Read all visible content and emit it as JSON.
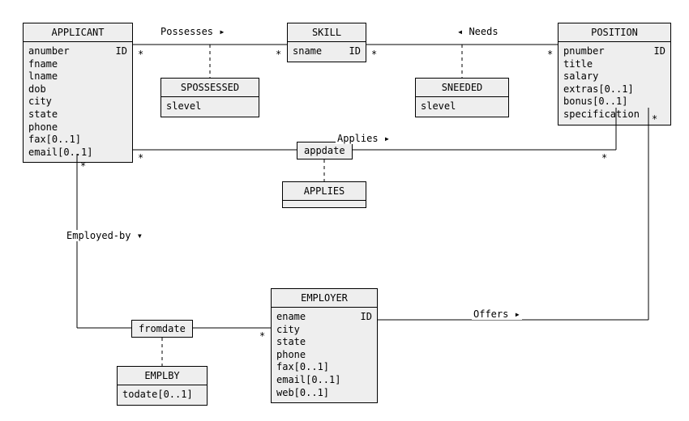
{
  "entities": {
    "applicant": {
      "title": "APPLICANT",
      "attrs": [
        {
          "name": "anumber",
          "id": "ID"
        },
        {
          "name": "fname",
          "id": ""
        },
        {
          "name": "lname",
          "id": ""
        },
        {
          "name": "dob",
          "id": ""
        },
        {
          "name": "city",
          "id": ""
        },
        {
          "name": "state",
          "id": ""
        },
        {
          "name": "phone",
          "id": ""
        },
        {
          "name": "fax[0..1]",
          "id": ""
        },
        {
          "name": "email[0..1]",
          "id": ""
        }
      ]
    },
    "skill": {
      "title": "SKILL",
      "attrs": [
        {
          "name": "sname",
          "id": "ID"
        }
      ]
    },
    "position": {
      "title": "POSITION",
      "attrs": [
        {
          "name": "pnumber",
          "id": "ID"
        },
        {
          "name": "title",
          "id": ""
        },
        {
          "name": "salary",
          "id": ""
        },
        {
          "name": "extras[0..1]",
          "id": ""
        },
        {
          "name": "bonus[0..1]",
          "id": ""
        },
        {
          "name": "specification",
          "id": ""
        }
      ]
    },
    "employer": {
      "title": "EMPLOYER",
      "attrs": [
        {
          "name": "ename",
          "id": "ID"
        },
        {
          "name": "city",
          "id": ""
        },
        {
          "name": "state",
          "id": ""
        },
        {
          "name": "phone",
          "id": ""
        },
        {
          "name": "fax[0..1]",
          "id": ""
        },
        {
          "name": "email[0..1]",
          "id": ""
        },
        {
          "name": "web[0..1]",
          "id": ""
        }
      ]
    },
    "spossessed": {
      "title": "SPOSSESSED",
      "attrs": [
        {
          "name": "slevel",
          "id": ""
        }
      ]
    },
    "sneeded": {
      "title": "SNEEDED",
      "attrs": [
        {
          "name": "slevel",
          "id": ""
        }
      ]
    },
    "applies": {
      "title": "APPLIES",
      "attrs": []
    },
    "emplby": {
      "title": "EMPLBY",
      "attrs": [
        {
          "name": "todate[0..1]",
          "id": ""
        }
      ]
    }
  },
  "assoc": {
    "appdate": "appdate",
    "fromdate": "fromdate"
  },
  "rels": {
    "possesses": "Possesses ▸",
    "needs": "◂ Needs",
    "applies": "Applies ▸",
    "employedby": "Employed-by ▾",
    "offers": "Offers ▸"
  },
  "mult": {
    "star": "*"
  }
}
